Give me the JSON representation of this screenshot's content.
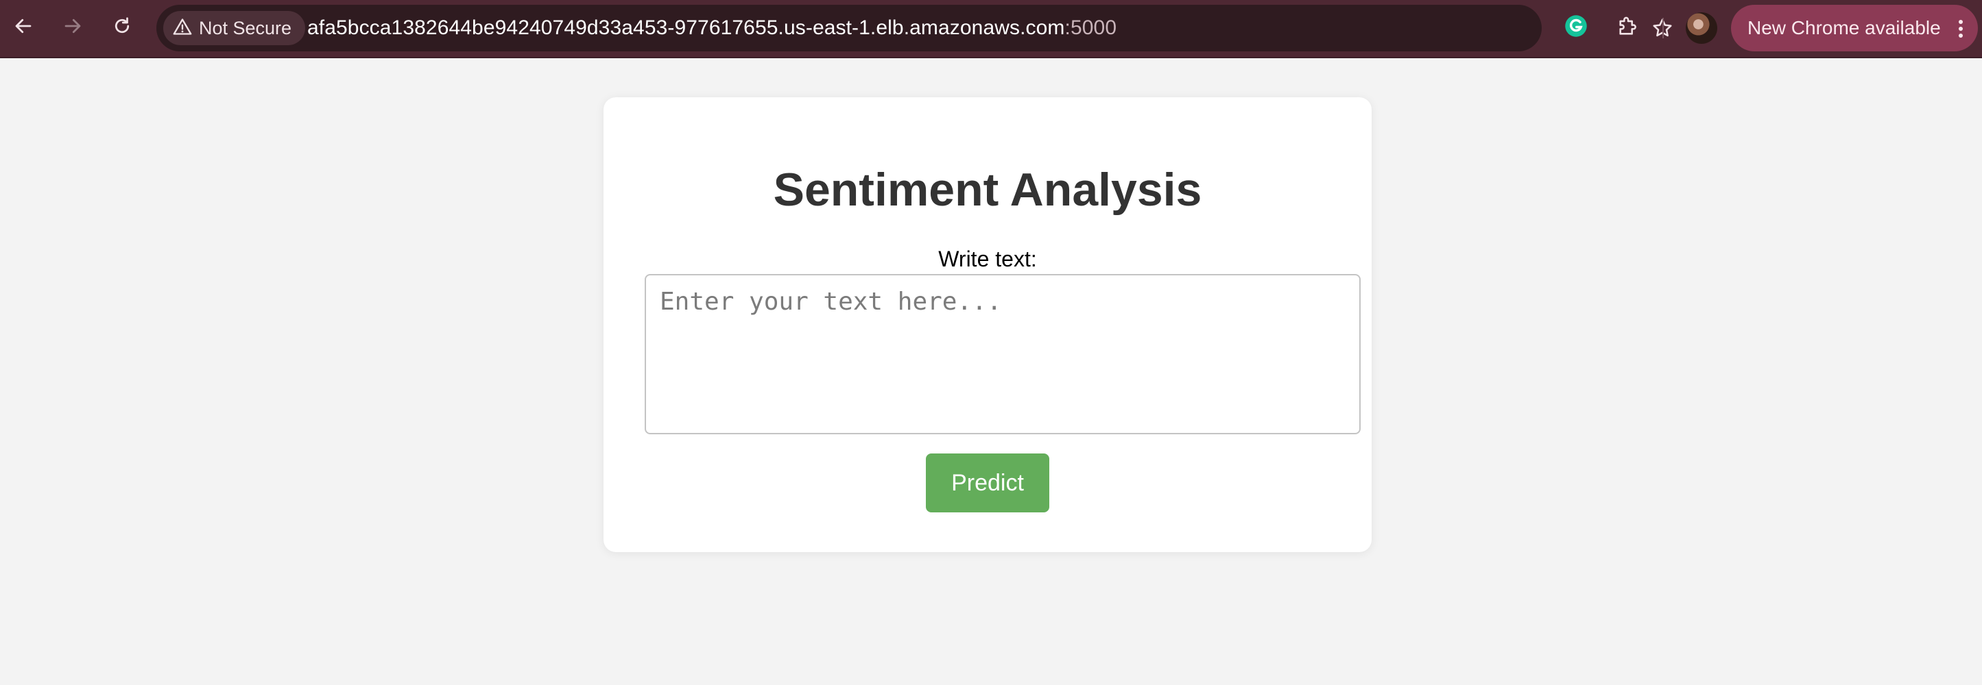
{
  "browser": {
    "security_label": "Not Secure",
    "url_host": "afa5bcca1382644be94240749d33a453-977617655.us-east-1.elb.amazonaws.com",
    "url_port": ":5000",
    "update_label": "New Chrome available",
    "icons": [
      "back-icon",
      "forward-icon",
      "reload-icon",
      "warning-icon",
      "star-icon",
      "grammarly-icon",
      "extensions-icon",
      "kebab-menu-icon"
    ],
    "colors": {
      "toolbar": "#4e2833",
      "omnibox": "#2f1b20",
      "update_chip": "#8c3a55"
    }
  },
  "page": {
    "title": "Sentiment Analysis",
    "input_label": "Write text:",
    "input_placeholder": "Enter your text here...",
    "input_value": "",
    "predict_label": "Predict",
    "colors": {
      "background": "#f3f3f3",
      "card": "#ffffff",
      "title": "#333333",
      "button": "#63ad5a"
    }
  }
}
